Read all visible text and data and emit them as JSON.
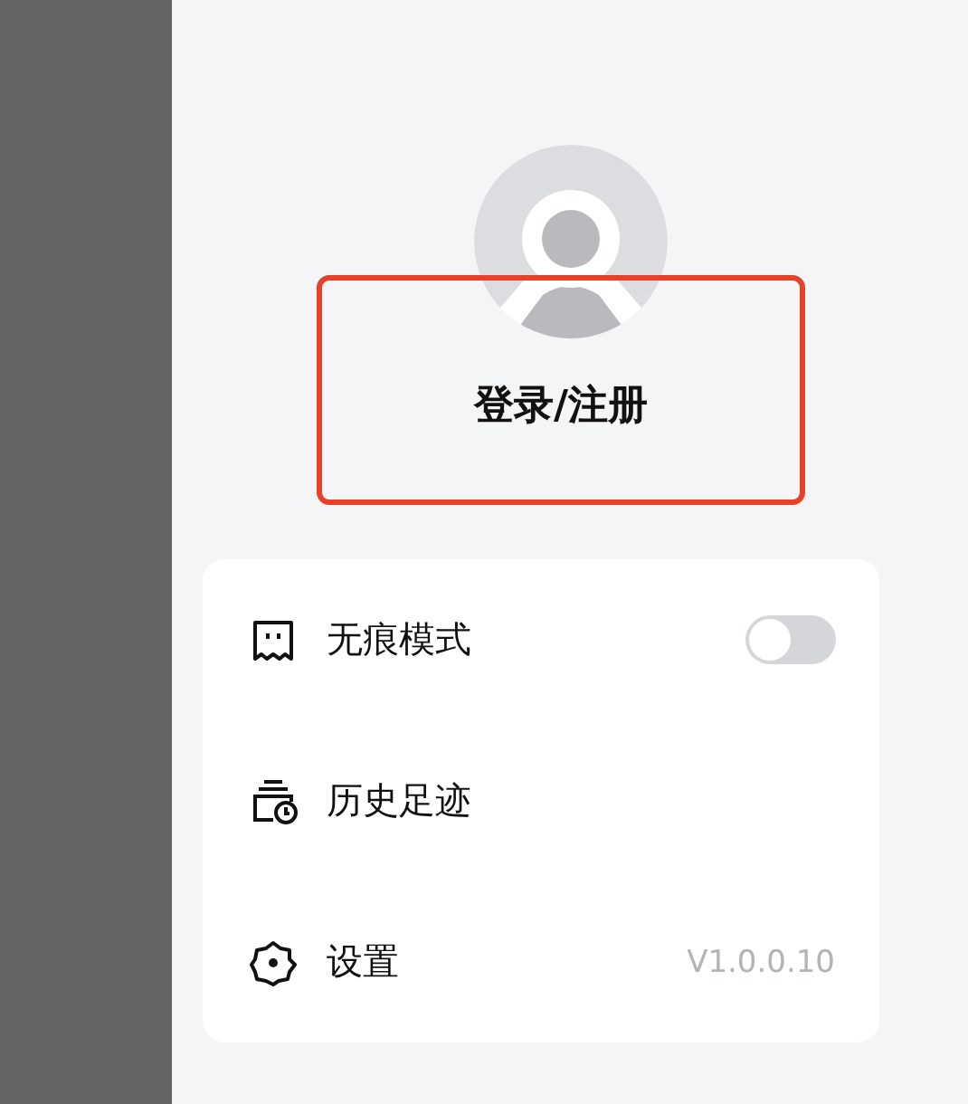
{
  "profile": {
    "login_label": "登录/注册",
    "highlighted": true
  },
  "menu": [
    {
      "kind": "toggle",
      "label": "无痕模式",
      "on": false
    },
    {
      "kind": "link",
      "label": "历史足迹"
    },
    {
      "kind": "info",
      "label": "设置",
      "value": "V1.0.0.10"
    }
  ]
}
